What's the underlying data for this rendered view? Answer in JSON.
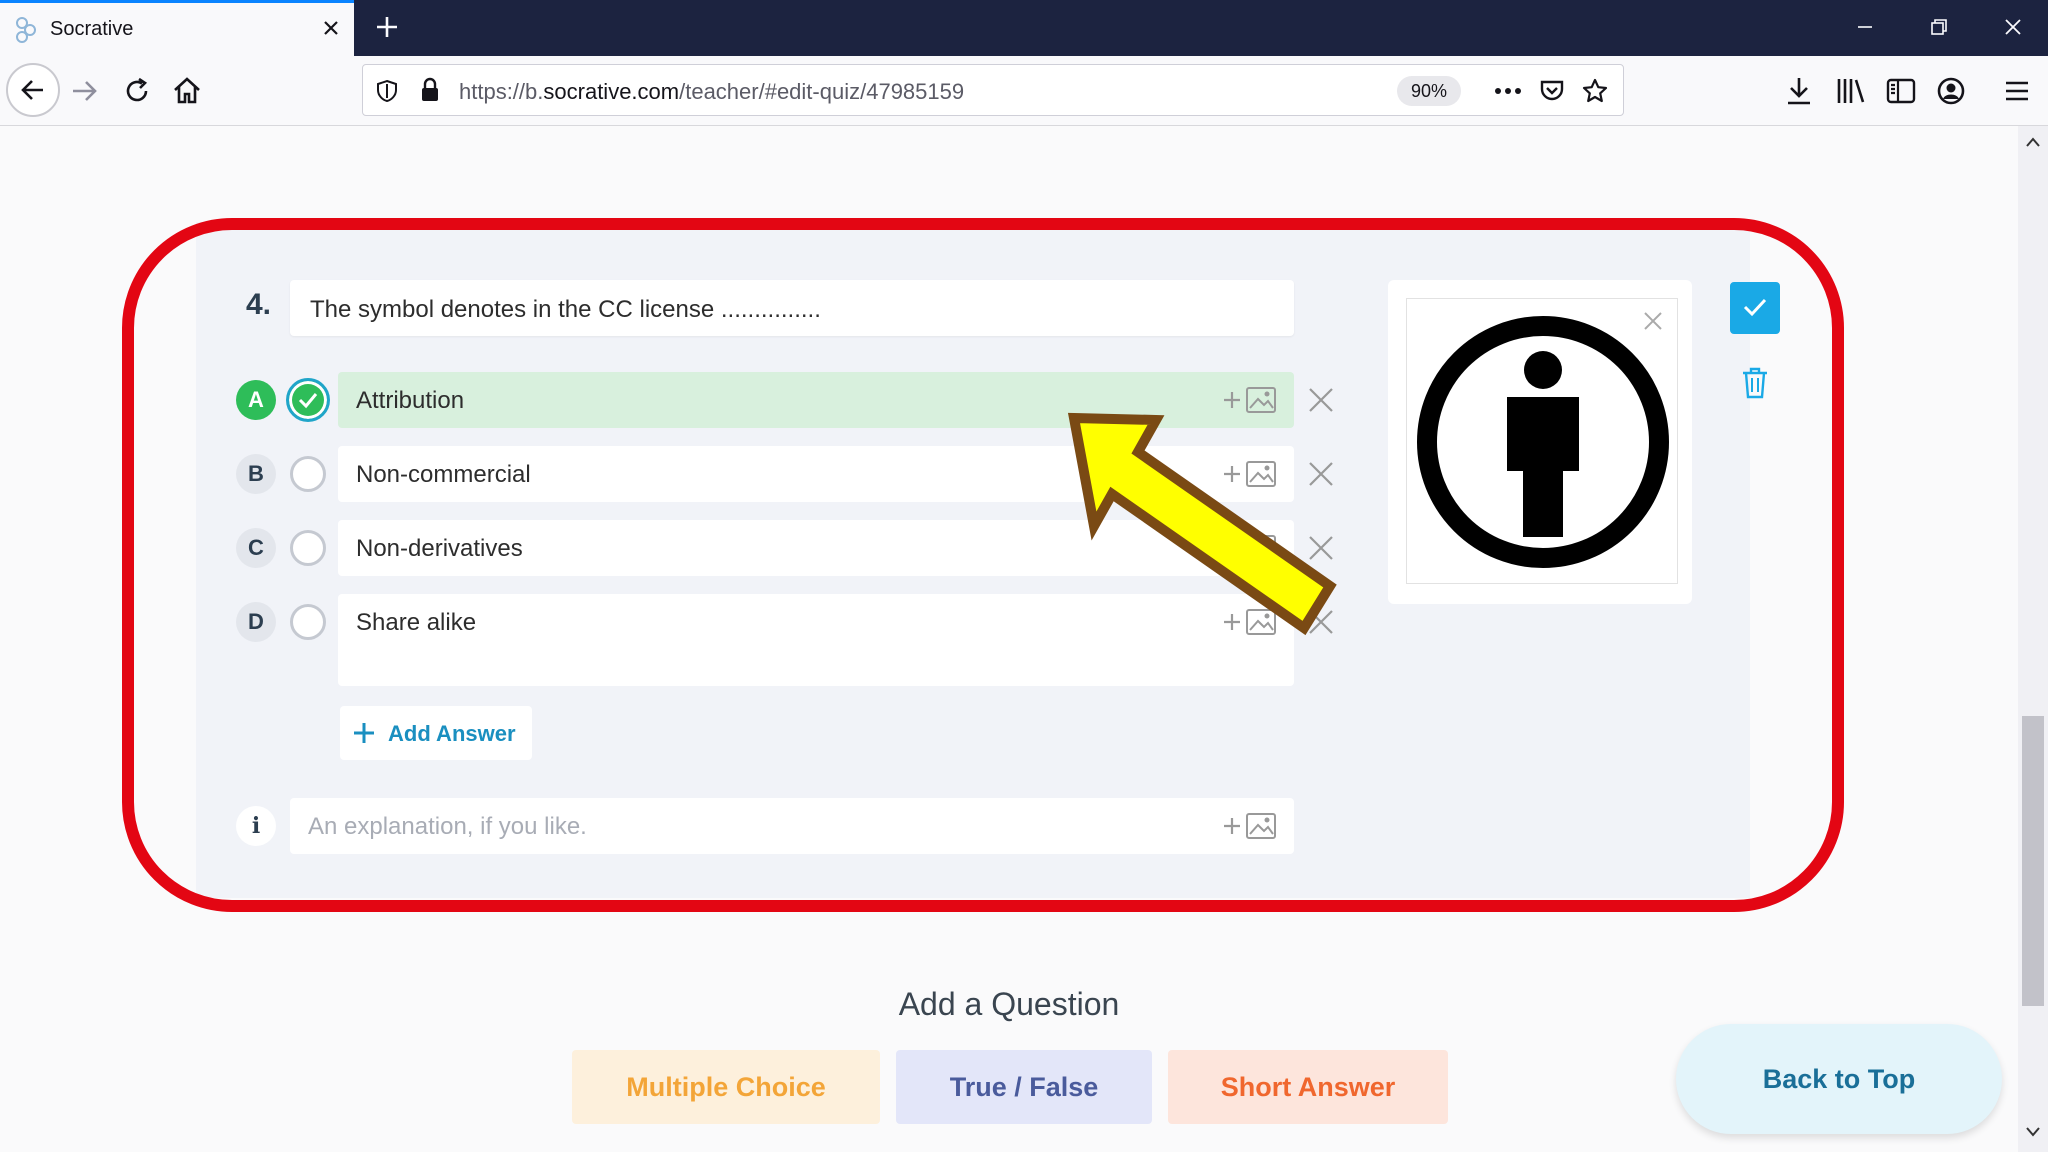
{
  "browser": {
    "tab_title": "Socrative",
    "url_prefix": "https://b.",
    "url_host": "socrative.com",
    "url_path": "/teacher/#edit-quiz/47985159",
    "zoom": "90%"
  },
  "question": {
    "number": "4.",
    "text": "The symbol denotes in the CC license ...............",
    "answers": [
      {
        "letter": "A",
        "text": "Attribution",
        "correct": true
      },
      {
        "letter": "B",
        "text": "Non-commercial",
        "correct": false
      },
      {
        "letter": "C",
        "text": "Non-derivatives",
        "correct": false
      },
      {
        "letter": "D",
        "text": "Share alike",
        "correct": false
      }
    ],
    "add_answer_label": "Add Answer",
    "explanation_marker": "i",
    "explanation_placeholder": "An explanation, if you like."
  },
  "add_question": {
    "title": "Add a Question",
    "types": [
      "Multiple Choice",
      "True / False",
      "Short Answer"
    ]
  },
  "back_to_top_label": "Back to Top",
  "colors": {
    "correct_green": "#2ebd59",
    "accent_blue": "#1aa9e6",
    "highlight_red": "#e30613",
    "arrow_yellow": "#ffff00"
  },
  "icons": [
    "socrative-logo-icon",
    "close-icon",
    "plus-icon",
    "minimize-icon",
    "restore-icon",
    "back-arrow-icon",
    "forward-arrow-icon",
    "reload-icon",
    "home-icon",
    "shield-icon",
    "lock-icon",
    "more-icon",
    "pocket-icon",
    "star-icon",
    "download-icon",
    "library-icon",
    "sidebar-icon",
    "account-icon",
    "menu-icon",
    "check-icon",
    "add-image-icon",
    "trash-icon",
    "cc-attribution-icon"
  ]
}
